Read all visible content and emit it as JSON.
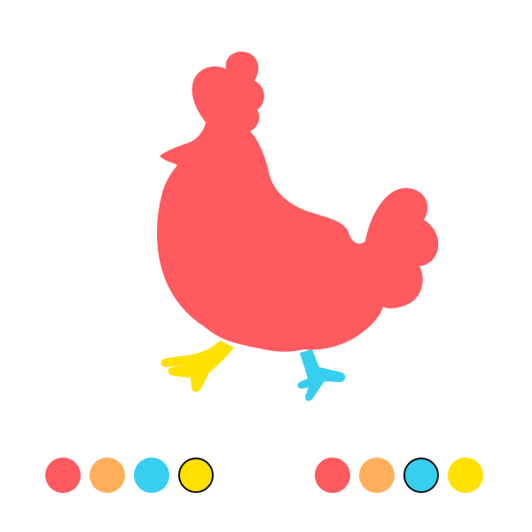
{
  "canvas": {
    "figure": "chicken",
    "parts": {
      "body": "#FF5A5F",
      "front_leg": "#FFE100",
      "back_leg": "#36CFEF"
    }
  },
  "palettes": {
    "front_leg": {
      "colors": [
        "#FF5A5F",
        "#FFAF5A",
        "#36CFEF",
        "#FFE100"
      ],
      "selected": "#FFE100"
    },
    "back_leg": {
      "colors": [
        "#FF5A5F",
        "#FFAF5A",
        "#36CFEF",
        "#FFE100"
      ],
      "selected": "#36CFEF"
    }
  }
}
